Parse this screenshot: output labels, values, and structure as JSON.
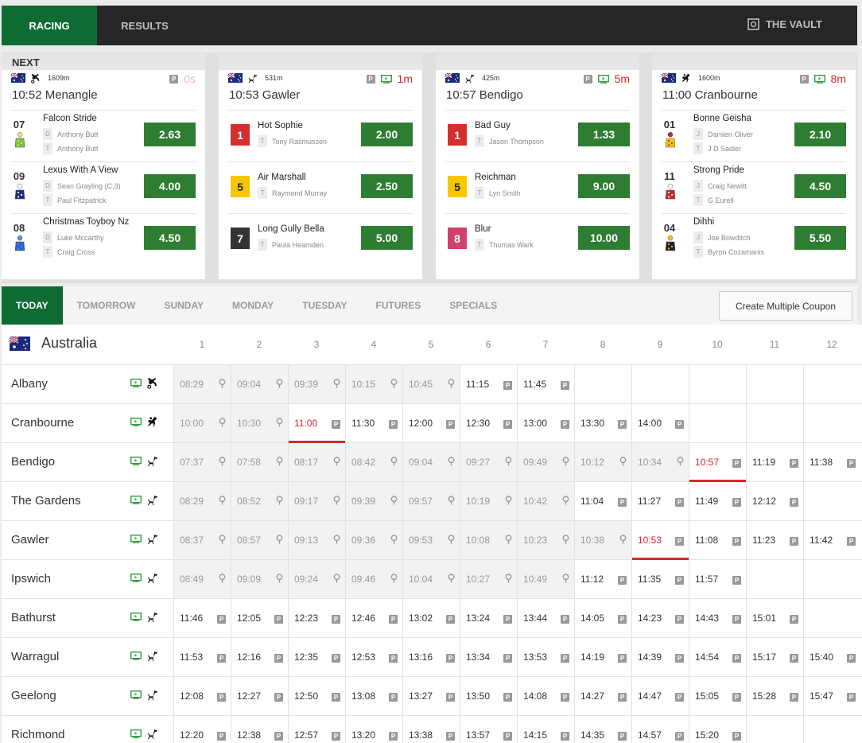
{
  "topnav": {
    "tabs": [
      "RACING",
      "RESULTS"
    ],
    "active": 0,
    "vault": "THE VAULT"
  },
  "next": {
    "title": "NEXT",
    "cards": [
      {
        "distance": "1609m",
        "countdown": "0s",
        "countdown_faded": true,
        "tv": false,
        "sport": "harness",
        "title": "10:52 Menangle",
        "runners": [
          {
            "num": "07",
            "name": "Falcon Stride",
            "line1_tag": "D",
            "line1": "Anthony Butt",
            "line2_tag": "T",
            "line2": "Anthony Butt",
            "odds": "2.63",
            "silk": "harness-green-yellow"
          },
          {
            "num": "09",
            "name": "Lexus With A View",
            "line1_tag": "D",
            "line1": "Sean Grayling (C,3)",
            "line2_tag": "T",
            "line2": "Paul Fitzpatrick",
            "odds": "4.00",
            "silk": "harness-navy-white"
          },
          {
            "num": "08",
            "name": "Christmas Toyboy Nz",
            "line1_tag": "D",
            "line1": "Luke Mccarthy",
            "line2_tag": "T",
            "line2": "Craig Cross",
            "odds": "4.50",
            "silk": "harness-blue"
          }
        ]
      },
      {
        "distance": "531m",
        "countdown": "1m",
        "countdown_faded": false,
        "tv": true,
        "sport": "greyhound",
        "title": "10:53 Gawler",
        "runners": [
          {
            "num": "1",
            "name": "Hot Sophie",
            "line2_tag": "T",
            "line2": "Tony Rasmussen",
            "odds": "2.00",
            "box": "#d32f2f",
            "box_text": "#ffffff"
          },
          {
            "num": "5",
            "name": "Air Marshall",
            "line2_tag": "T",
            "line2": "Raymond Murray",
            "odds": "2.50",
            "box": "#f7c600",
            "box_text": "#222222"
          },
          {
            "num": "7",
            "name": "Long Gully Bella",
            "line2_tag": "T",
            "line2": "Paula Hearnden",
            "odds": "5.00",
            "box": "#333333",
            "box_text": "#ffffff"
          }
        ]
      },
      {
        "distance": "425m",
        "countdown": "5m",
        "countdown_faded": false,
        "tv": true,
        "sport": "greyhound",
        "title": "10:57 Bendigo",
        "runners": [
          {
            "num": "1",
            "name": "Bad Guy",
            "line2_tag": "T",
            "line2": "Jason Thompson",
            "odds": "1.33",
            "box": "#d32f2f",
            "box_text": "#ffffff"
          },
          {
            "num": "5",
            "name": "Reichman",
            "line2_tag": "T",
            "line2": "Lyn Smith",
            "odds": "9.00",
            "box": "#f7c600",
            "box_text": "#222222"
          },
          {
            "num": "8",
            "name": "Blur",
            "line2_tag": "T",
            "line2": "Thomas Wark",
            "odds": "10.00",
            "box": "#d0416d",
            "box_text": "#ffffff"
          }
        ]
      },
      {
        "distance": "1600m",
        "countdown": "8m",
        "countdown_faded": false,
        "tv": true,
        "sport": "thoroughbred",
        "title": "11:00 Cranbourne",
        "runners": [
          {
            "num": "01",
            "name": "Bonne Geisha",
            "line1_tag": "J",
            "line1": "Damien Oliver",
            "line2_tag": "T",
            "line2": "J D Sadler",
            "odds": "2.10",
            "silk": "jockey-yellow-red"
          },
          {
            "num": "11",
            "name": "Strong Pride",
            "line1_tag": "J",
            "line1": "Craig Newitt",
            "line2_tag": "T",
            "line2": "G Eurell",
            "odds": "4.50",
            "silk": "jockey-red-white"
          },
          {
            "num": "04",
            "name": "Dihhi",
            "line1_tag": "J",
            "line1": "Joe Bowditch",
            "line2_tag": "T",
            "line2": "Byron Cozamanis",
            "odds": "5.50",
            "silk": "jockey-black-yellow"
          }
        ]
      }
    ]
  },
  "daytabs": {
    "tabs": [
      "TODAY",
      "TOMORROW",
      "SUNDAY",
      "MONDAY",
      "TUESDAY",
      "FUTURES",
      "SPECIALS"
    ],
    "active": 0,
    "coupon": "Create Multiple Coupon"
  },
  "grid": {
    "country": "Australia",
    "columns": [
      "1",
      "2",
      "3",
      "4",
      "5",
      "6",
      "7",
      "8",
      "9",
      "10",
      "11",
      "12"
    ],
    "rows": [
      {
        "venue": "Albany",
        "sport": "harness",
        "times": [
          "08:29",
          "09:04",
          "09:39",
          "10:15",
          "10:45",
          "11:15",
          "11:45"
        ],
        "done": 5,
        "next": -1
      },
      {
        "venue": "Cranbourne",
        "sport": "thoroughbred",
        "times": [
          "10:00",
          "10:30",
          "11:00",
          "11:30",
          "12:00",
          "12:30",
          "13:00",
          "13:30",
          "14:00"
        ],
        "done": 2,
        "next": 2
      },
      {
        "venue": "Bendigo",
        "sport": "greyhound",
        "times": [
          "07:37",
          "07:58",
          "08:17",
          "08:42",
          "09:04",
          "09:27",
          "09:49",
          "10:12",
          "10:34",
          "10:57",
          "11:19",
          "11:38"
        ],
        "done": 9,
        "next": 9
      },
      {
        "venue": "The Gardens",
        "sport": "greyhound",
        "times": [
          "08:29",
          "08:52",
          "09:17",
          "09:39",
          "09:57",
          "10:19",
          "10:42",
          "11:04",
          "11:27",
          "11:49",
          "12:12"
        ],
        "done": 7,
        "next": -1
      },
      {
        "venue": "Gawler",
        "sport": "greyhound",
        "times": [
          "08:37",
          "08:57",
          "09:13",
          "09:36",
          "09:53",
          "10:08",
          "10:23",
          "10:38",
          "10:53",
          "11:08",
          "11:23",
          "11:42"
        ],
        "done": 8,
        "next": 8
      },
      {
        "venue": "Ipswich",
        "sport": "greyhound",
        "times": [
          "08:49",
          "09:09",
          "09:24",
          "09:46",
          "10:04",
          "10:27",
          "10:49",
          "11:12",
          "11:35",
          "11:57"
        ],
        "done": 7,
        "next": -1
      },
      {
        "venue": "Bathurst",
        "sport": "greyhound",
        "times": [
          "11:46",
          "12:05",
          "12:23",
          "12:46",
          "13:02",
          "13:24",
          "13:44",
          "14:05",
          "14:23",
          "14:43",
          "15:01"
        ],
        "done": 0,
        "next": -1
      },
      {
        "venue": "Warragul",
        "sport": "greyhound",
        "times": [
          "11:53",
          "12:16",
          "12:35",
          "12:53",
          "13:16",
          "13:34",
          "13:53",
          "14:19",
          "14:39",
          "14:54",
          "15:17",
          "15:40"
        ],
        "done": 0,
        "next": -1
      },
      {
        "venue": "Geelong",
        "sport": "greyhound",
        "times": [
          "12:08",
          "12:27",
          "12:50",
          "13:08",
          "13:27",
          "13:50",
          "14:08",
          "14:27",
          "14:47",
          "15:05",
          "15:28",
          "15:47"
        ],
        "done": 0,
        "next": -1
      },
      {
        "venue": "Richmond",
        "sport": "greyhound",
        "times": [
          "12:20",
          "12:38",
          "12:57",
          "13:20",
          "13:38",
          "13:57",
          "14:15",
          "14:35",
          "14:57",
          "15:20"
        ],
        "done": 0,
        "next": -1
      }
    ]
  },
  "colors": {
    "brand_green": "#0f6b34",
    "odds_green": "#2e7d32",
    "alert_red": "#d9262a"
  }
}
